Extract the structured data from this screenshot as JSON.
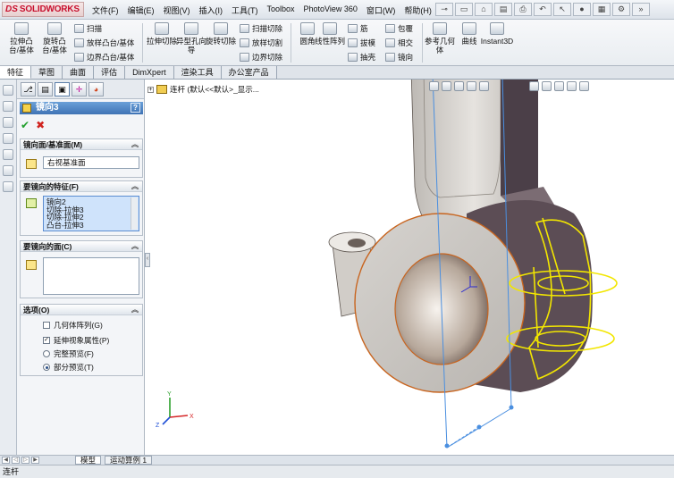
{
  "app": {
    "logo_text": "SOLIDWORKS",
    "logo_mark": "DS"
  },
  "menu": [
    "文件(F)",
    "编辑(E)",
    "视图(V)",
    "插入(I)",
    "工具(T)",
    "Toolbox",
    "PhotoView 360",
    "窗口(W)",
    "帮助(H)"
  ],
  "command_manager": {
    "extrude_boss": "拉伸凸台/基体",
    "revolve_boss": "旋转凸台/基体",
    "sweep": "扫描",
    "loft_boss": "放样凸台/基体",
    "boundary_boss": "边界凸台/基体",
    "extrude_cut": "拉伸切除",
    "hole_wizard": "异型孔向导",
    "revolve_cut": "旋转切除",
    "swept_cut": "扫描切除",
    "lofted_cut": "放样切割",
    "boundary_cut": "边界切除",
    "fillet": "圆角",
    "linear_pattern": "线性阵列",
    "rib": "筋",
    "draft": "拔模",
    "shell": "抽壳",
    "wrap": "包覆",
    "intersect": "相交",
    "mirror": "镜向",
    "ref_geometry": "参考几何体",
    "curves": "曲线",
    "instant3d": "Instant3D"
  },
  "tabs": [
    "特征",
    "草图",
    "曲面",
    "评估",
    "DimXpert",
    "渲染工具",
    "办公室产品"
  ],
  "property_manager": {
    "title": "镜向3",
    "help_label": "?",
    "ok_label": "✔",
    "cancel_label": "✖",
    "mirror_plane_header": "镜向面/基准面(M)",
    "mirror_plane_value": "右视基准面",
    "features_header": "要镜向的特征(F)",
    "features_list": [
      "镜向2",
      "切除-拉伸3",
      "切除-拉伸2",
      "凸台-拉伸3"
    ],
    "faces_header": "要镜向的面(C)",
    "options_header": "选项(O)",
    "option_geometry_pattern": "几何体阵列(G)",
    "option_propagate": "延伸视象属性(P)",
    "option_full_preview": "完整预览(F)",
    "option_partial_preview": "部分预览(T)",
    "option_geometry_pattern_checked": false,
    "option_propagate_checked": true,
    "preview_mode": "partial"
  },
  "tree": {
    "part_label": "连杆  (默认<<默认>_显示..."
  },
  "bottom_tabs": [
    "模型",
    "运动算例 1"
  ],
  "status_text": "连杆",
  "colors": {
    "highlight_yellow": "#f2e600",
    "edge_orange": "#c8641e",
    "part_grey": "#c9c6c2",
    "plane_blue": "#4a8fe0"
  }
}
